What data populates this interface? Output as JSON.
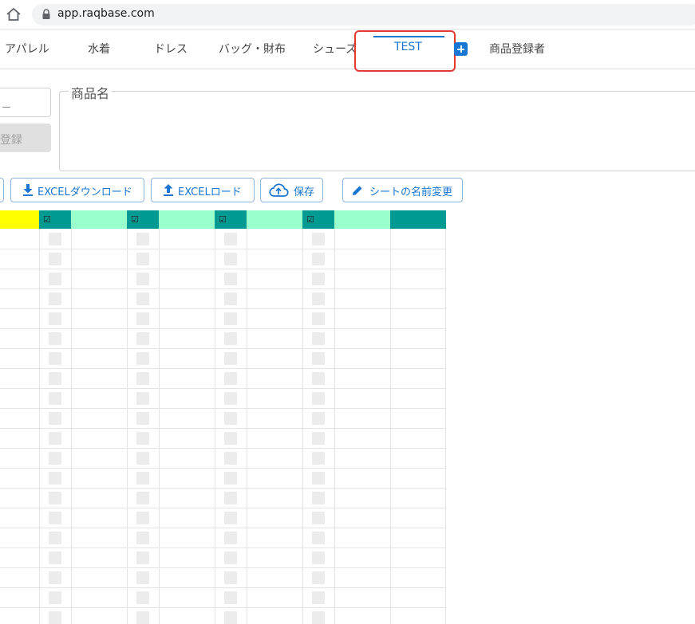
{
  "browser": {
    "url": "app.raqbase.com"
  },
  "tabs": {
    "items": [
      {
        "label": "アパレル"
      },
      {
        "label": "水着"
      },
      {
        "label": "ドレス"
      },
      {
        "label": "バッグ・財布"
      },
      {
        "label": "シューズ"
      },
      {
        "label": "TEST"
      },
      {
        "label": "商品登録者"
      }
    ],
    "active": "TEST"
  },
  "form": {
    "small_field_value": "ー",
    "register_label": "登録",
    "product_name_legend": "商品名"
  },
  "toolbar": {
    "download_label": "EXCELダウンロード",
    "load_label": "EXCELロード",
    "save_label": "保存",
    "rename_label": "シートの名前変更"
  },
  "grid": {
    "check_mark": "☑",
    "colors": {
      "yellow": "#ffff00",
      "teal": "#009a93",
      "mint": "#99ffcc"
    },
    "row_count": 20
  }
}
